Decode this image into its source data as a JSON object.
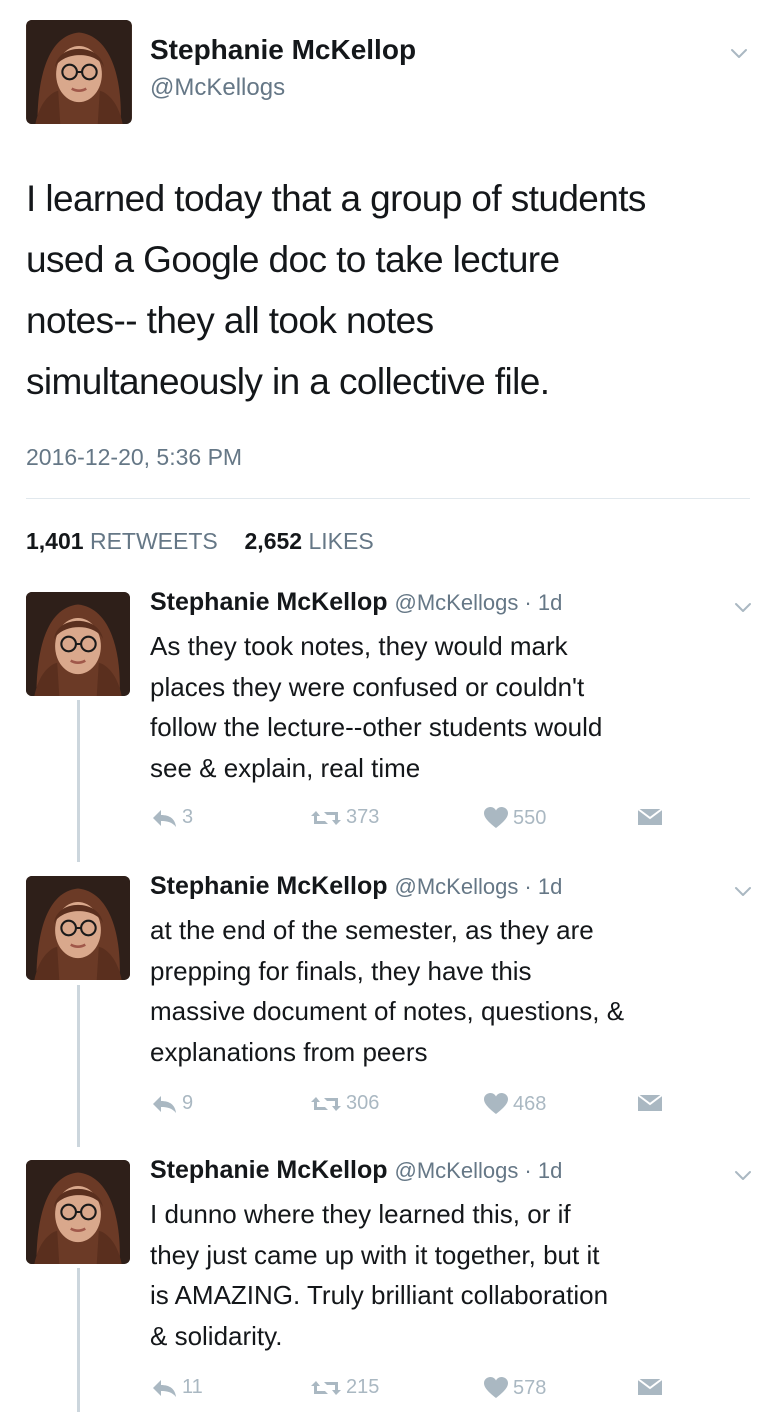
{
  "main_tweet": {
    "name": "Stephanie McKellop",
    "handle": "@McKellogs",
    "text_lines": [
      "I learned today that a group of students",
      "used a Google doc to take lecture",
      "notes-- they all took notes",
      "simultaneously in a collective file."
    ],
    "timestamp": "2016-12-20, 5:36 PM",
    "retweets_count": "1,401",
    "retweets_label": "RETWEETS",
    "likes_count": "2,652",
    "likes_label": "LIKES"
  },
  "replies": [
    {
      "name": "Stephanie McKellop",
      "handle_time": "@McKellogs · 1d",
      "text_lines": [
        "As they took notes, they would mark",
        "places they were confused or couldn't",
        "follow the lecture--other students would",
        "see & explain, real time"
      ],
      "reply_count": "3",
      "retweet_count": "373",
      "like_count": "550"
    },
    {
      "name": "Stephanie McKellop",
      "handle_time": "@McKellogs · 1d",
      "text_lines": [
        "at the end of the semester, as they are",
        "prepping for finals, they have this",
        "massive document of notes, questions, &",
        "explanations from peers"
      ],
      "reply_count": "9",
      "retweet_count": "306",
      "like_count": "468"
    },
    {
      "name": "Stephanie McKellop",
      "handle_time": "@McKellogs · 1d",
      "text_lines": [
        "I dunno where they learned this, or if",
        "they just came up with it together, but it",
        "is AMAZING. Truly brilliant collaboration",
        "& solidarity."
      ],
      "reply_count": "11",
      "retweet_count": "215",
      "like_count": "578"
    }
  ],
  "colors": {
    "text": "#14171a",
    "secondary": "#657786",
    "icon_gray": "#aab8c2",
    "divider": "#e1e8ed",
    "thread_line": "#ccd6dd"
  },
  "icons": {
    "reply": "reply-arrow-icon",
    "retweet": "retweet-icon",
    "like": "heart-icon",
    "dm": "envelope-icon",
    "menu": "chevron-down-icon"
  }
}
